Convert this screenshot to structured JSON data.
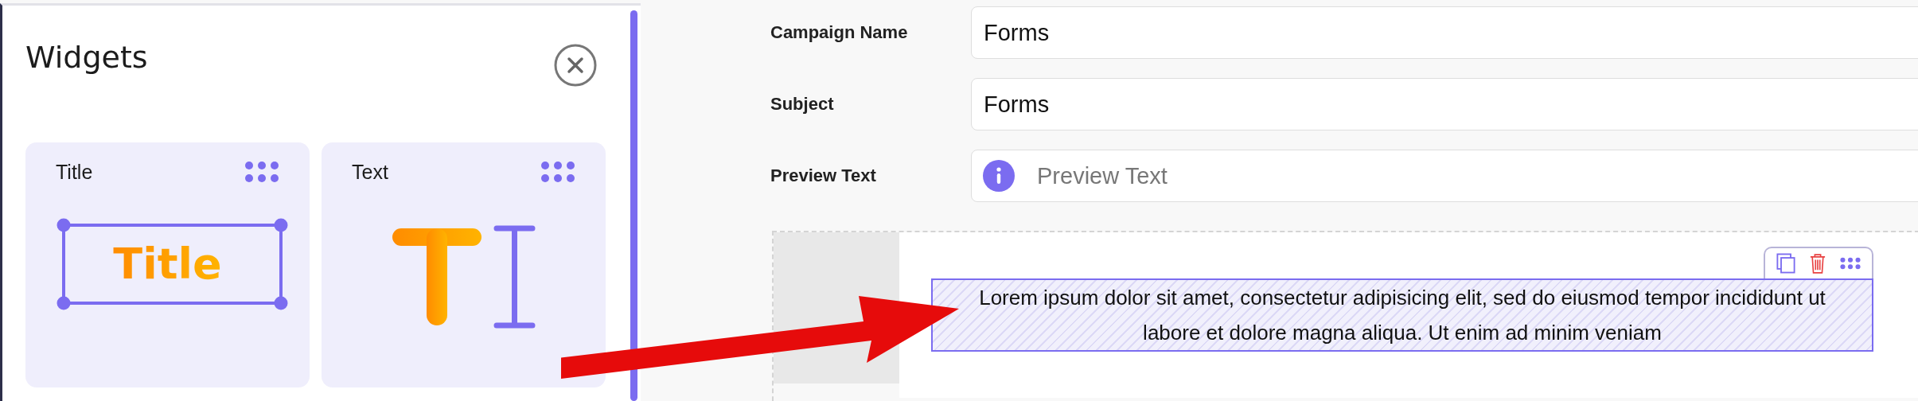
{
  "panel": {
    "title": "Widgets",
    "widgets": [
      {
        "kind": "title",
        "label": "Title",
        "preview": "Title"
      },
      {
        "kind": "text",
        "label": "Text"
      }
    ]
  },
  "form": {
    "fields": [
      {
        "label": "Campaign Name",
        "value": "Forms"
      },
      {
        "label": "Subject",
        "value": "Forms"
      },
      {
        "label": "Preview Text",
        "placeholder": "Preview Text",
        "kind": "info"
      }
    ]
  },
  "editor": {
    "text_block": "Lorem ipsum dolor sit amet, consectetur adipisicing elit, sed do eiusmod tempor incididunt ut labore et dolore magna aliqua. Ut enim ad minim veniam"
  }
}
